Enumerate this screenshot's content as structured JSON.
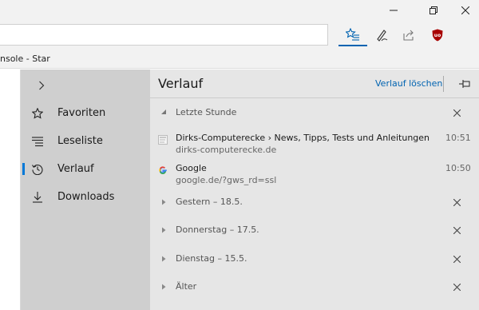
{
  "titlebar": {
    "minimize_glyph": "—",
    "maximize_glyph": "❐",
    "close_glyph": "✕"
  },
  "toolbar": {
    "more_glyph": "···",
    "icons": [
      "hub-favorites-icon",
      "notes-pen-icon",
      "share-icon",
      "ublock-origin-icon",
      "more-icon"
    ]
  },
  "favorites_bar": {
    "item_label": "nsole - Star"
  },
  "hub_nav": {
    "items": [
      {
        "label": "Favoriten"
      },
      {
        "label": "Leseliste"
      },
      {
        "label": "Verlauf"
      },
      {
        "label": "Downloads"
      }
    ],
    "active_index": 2,
    "accent_color": "#0078d7"
  },
  "history": {
    "title": "Verlauf",
    "clear_label": "Verlauf löschen",
    "groups": [
      {
        "label": "Letzte Stunde",
        "expanded": true,
        "entries": [
          {
            "title": "Dirks-Computerecke › News, Tipps, Tests und Anleitungen",
            "url": "dirks-computerecke.de",
            "time": "10:51",
            "favicon": "site-favicon"
          },
          {
            "title": "Google",
            "url": "google.de/?gws_rd=ssl",
            "time": "10:50",
            "favicon": "google-favicon"
          }
        ]
      },
      {
        "label": "Gestern – 18.5.",
        "expanded": false
      },
      {
        "label": "Donnerstag – 17.5.",
        "expanded": false
      },
      {
        "label": "Dienstag – 15.5.",
        "expanded": false
      },
      {
        "label": "Älter",
        "expanded": false
      }
    ]
  },
  "colors": {
    "link": "#0063b1",
    "hub_nav_bg": "#cfcfcf",
    "hub_panel_bg": "#e6e6e6",
    "ublock_red": "#a80000"
  }
}
